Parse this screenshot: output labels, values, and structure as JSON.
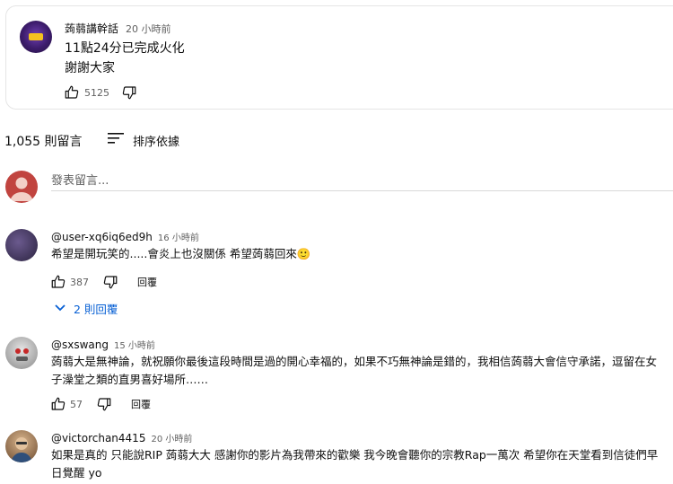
{
  "post": {
    "author": "蒟蒻講幹話",
    "time": "20 小時前",
    "lines": [
      "11點24分已完成火化",
      "謝謝大家"
    ],
    "likes": "5125"
  },
  "comments_header": {
    "count": "1,055 則留言",
    "sort_label": "排序依據"
  },
  "add_comment": {
    "placeholder": "發表留言..."
  },
  "comments": [
    {
      "author": "@user-xq6iq6ed9h",
      "time": "16 小時前",
      "text": "希望是開玩笑的.....會炎上也沒關係 希望蒟蒻回來🙂",
      "likes": "387",
      "reply_label": "回覆",
      "replies_label": "2 則回覆"
    },
    {
      "author": "@sxswang",
      "time": "15 小時前",
      "text_lines": [
        "蒟蒻大是無神論，就祝願你最後這段時間是過的開心幸福的，如果不巧無神論是錯的，我相信蒟蒻大會信守承諾，逗留在女",
        "子澡堂之類的直男喜好場所……"
      ],
      "likes": "57",
      "reply_label": "回覆"
    },
    {
      "author": "@victorchan4415",
      "time": "20 小時前",
      "text_lines": [
        "如果是真的 只能說RIP 蒟蒻大大 感謝你的影片為我帶來的歡樂 我今晚會聽你的宗教Rap一萬次 希望你在天堂看到信徒們早",
        "日覺醒 yo"
      ]
    }
  ],
  "icons": {
    "like": "thumbs-up-icon",
    "dislike": "thumbs-down-icon",
    "sort": "sort-icon",
    "chevron": "chevron-down-icon"
  },
  "colors": {
    "accent_blue": "#065fd4",
    "secondary_text": "#606060",
    "avatar_red": "#c1443f"
  }
}
